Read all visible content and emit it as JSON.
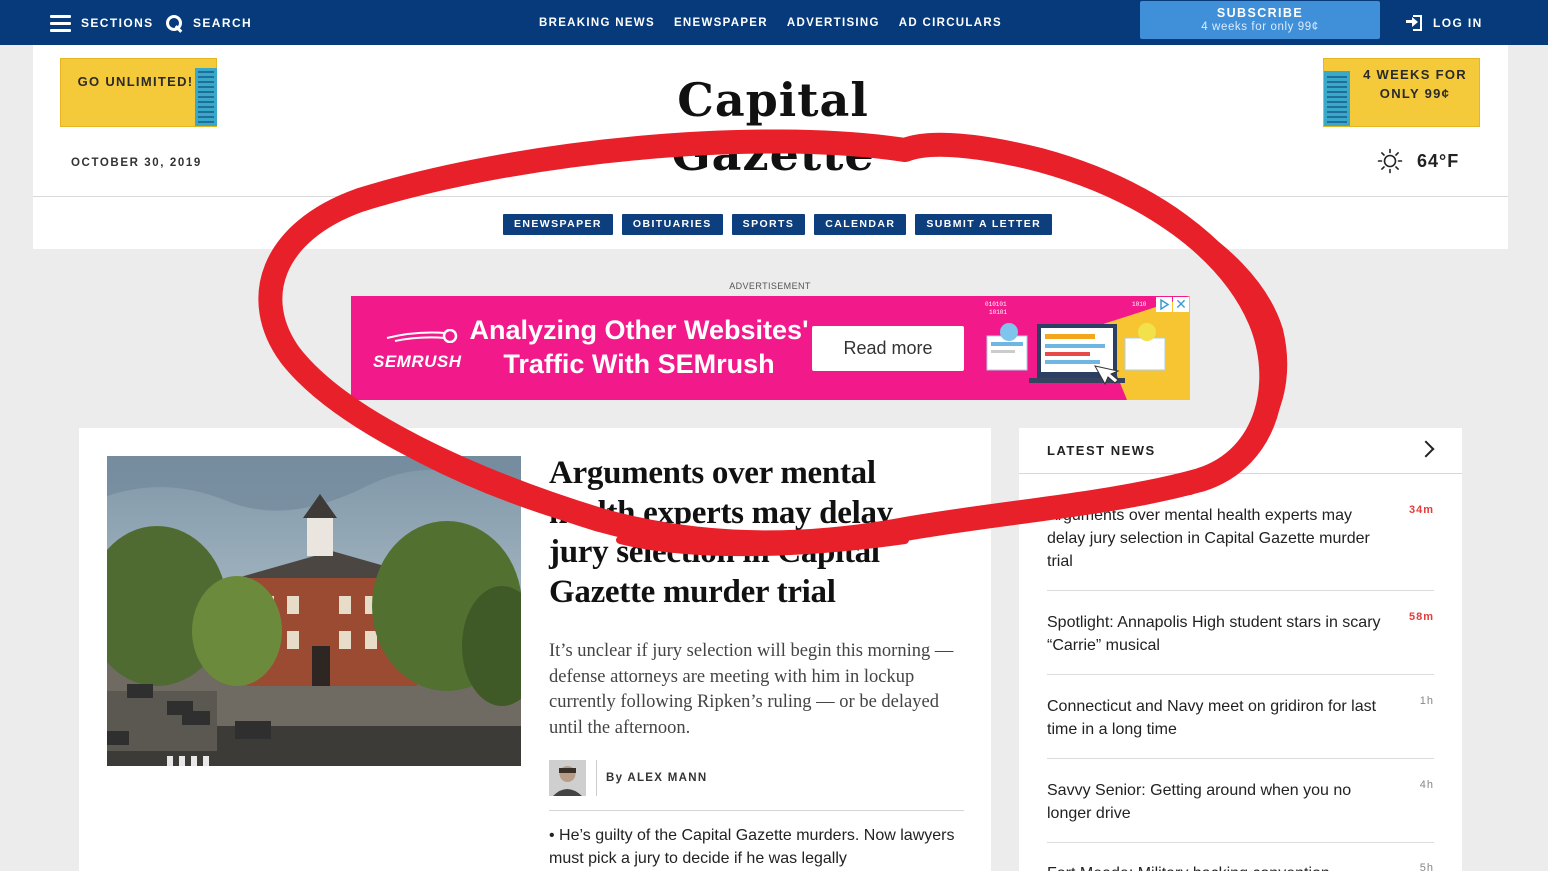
{
  "topbar": {
    "sections_label": "SECTIONS",
    "search_label": "SEARCH",
    "nav": [
      "BREAKING NEWS",
      "ENEWSPAPER",
      "ADVERTISING",
      "AD CIRCULARS"
    ],
    "subscribe_title": "SUBSCRIBE",
    "subscribe_sub": "4 weeks for only 99¢",
    "login_label": "LOG IN"
  },
  "masthead": {
    "logo": "Capital Gazette",
    "promo_left": "GO UNLIMITED!",
    "promo_right": "4 WEEKS FOR ONLY 99¢",
    "date": "OCTOBER 30, 2019",
    "temperature": "64°F",
    "weather_icon": "sun-icon",
    "pills": [
      "ENEWSPAPER",
      "OBITUARIES",
      "SPORTS",
      "CALENDAR",
      "SUBMIT A LETTER"
    ]
  },
  "ad": {
    "label": "ADVERTISEMENT",
    "brand": "SEMRUSH",
    "headline_1": "Analyzing Other Websites'",
    "headline_2": "Traffic With SEMrush",
    "button": "Read more",
    "close": "✕"
  },
  "story": {
    "headline": "Arguments over mental health experts may delay jury selection in Capital Gazette murder trial",
    "dek": "It’s unclear if jury selection will begin this morning — defense attorneys are meeting with him in lockup currently following Ripken’s ruling — or be delayed until the afternoon.",
    "byline": "By ALEX MANN",
    "related": "• He’s guilty of the Capital Gazette murders. Now lawyers must pick a jury to decide if he was legally"
  },
  "latest": {
    "title": "LATEST NEWS",
    "items": [
      {
        "text": "Arguments over mental health experts may delay jury selection in Capital Gazette murder trial",
        "time": "34m"
      },
      {
        "text": "Spotlight: Annapolis High student stars in scary “Carrie” musical",
        "time": "58m"
      },
      {
        "text": "Connecticut and Navy meet on gridiron for last time in a long time",
        "time": "1h"
      },
      {
        "text": "Savvy Senior: Getting around when you no longer drive",
        "time": "4h"
      },
      {
        "text": "Fort Meade: Military hacking convention",
        "time": "5h"
      }
    ]
  },
  "colors": {
    "topbar": "#063a7a",
    "subscribe": "#3f8fd9",
    "promo": "#f4c93a",
    "ad_bg": "#f2198a",
    "annotation": "#e8202a",
    "time_recent": "#e43c3c"
  }
}
